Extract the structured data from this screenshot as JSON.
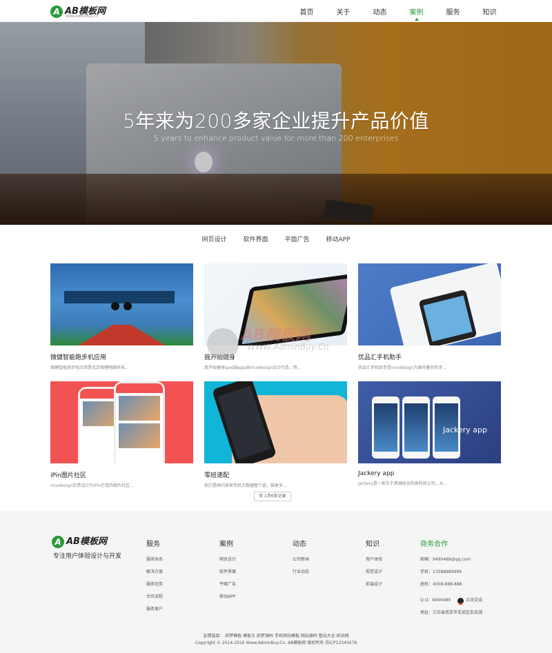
{
  "header": {
    "logo_text": "AB模板网",
    "logo_sub": "Www.AdminBuy.Cn",
    "nav": [
      "首页",
      "关于",
      "动态",
      "案例",
      "服务",
      "知识"
    ],
    "active_nav": "案例",
    "accent": "#2a9a3a"
  },
  "hero": {
    "title": "5年来为200多家企业提升产品价值",
    "subtitle": "5 years to enhance product value for more than 200 enterprises"
  },
  "tabs": [
    "网页设计",
    "软件界面",
    "平面广告",
    "移动APP"
  ],
  "cases": [
    {
      "title": "微健智能跑步机应用",
      "desc": "微健智能跑步机应用是北京微健网络科技..."
    },
    {
      "title": "我开始健身",
      "desc": "我开始健身ipad端app由nicedesign设计打造，用..."
    },
    {
      "title": "优品汇手机助手",
      "desc": "优品汇手机助手是nicedesign为国内著名的手..."
    },
    {
      "title": "iPin图片社区",
      "desc": "nicedesign负责设计为iPin打造的图片社区..."
    },
    {
      "title": "零班速配",
      "desc": "我们是国内首家司机大数据整个链，做更多..."
    },
    {
      "title": "Jackery app",
      "desc": "Jackery是一家位于美国硅谷的高科技公司，从..."
    }
  ],
  "case6_overlay": "Jackery app",
  "watermark": {
    "text": "AB模板网",
    "sub": "WWW.AdminBuy.Cn"
  },
  "pager": "共 1页6条记录",
  "footer": {
    "slogan": "专注用户体验设计与开发",
    "columns": [
      {
        "heading": "服务",
        "items": [
          "服务体系",
          "解决方案",
          "服务优势",
          "合作流程",
          "服务客户"
        ]
      },
      {
        "heading": "案例",
        "items": [
          "网页设计",
          "软件界面",
          "平面广告",
          "移动APP"
        ]
      },
      {
        "heading": "动态",
        "items": [
          "公司新闻",
          "行业动态"
        ]
      },
      {
        "heading": "知识",
        "items": [
          "用户体验",
          "视觉设计",
          "前端设计"
        ]
      }
    ],
    "contact": {
      "heading": "商务合作",
      "email": "邮箱：9490489@qq.com",
      "mobile": "手机：13588889999",
      "phone": "座机：4008-888-888",
      "qq": "Q Q：9490489",
      "qq_action": "点击交谈",
      "address": "地址：江苏省南京市玄武区玄武湖"
    },
    "links": "友情链接：  织梦模板  模板王  织梦源码  手机网站模板  网站源码  整站大全  织站网",
    "copyright": "Copyright © 2014-2016 Www.AdminBuy.Cn. AB模板网 版权所有 苏ICP12345678"
  }
}
